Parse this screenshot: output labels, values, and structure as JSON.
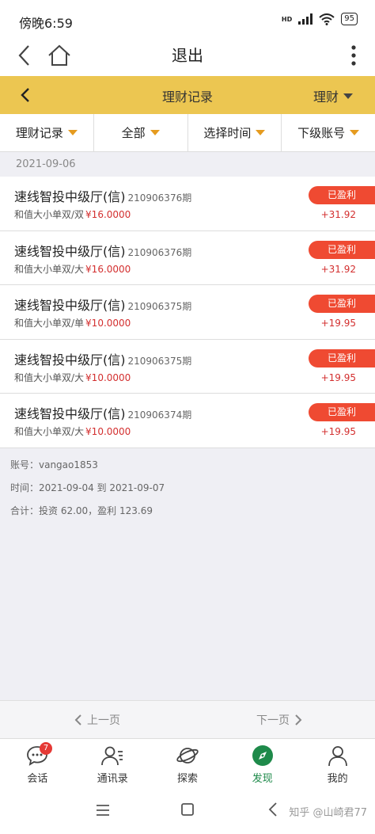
{
  "status": {
    "time": "傍晚6:59",
    "network": "HD",
    "battery": "95"
  },
  "appbar": {
    "title": "退出"
  },
  "section": {
    "title": "理财记录",
    "menu_label": "理财"
  },
  "filters": [
    {
      "label": "理财记录"
    },
    {
      "label": "全部"
    },
    {
      "label": "选择时间"
    },
    {
      "label": "下级账号"
    }
  ],
  "date_header": "2021-09-06",
  "records": [
    {
      "name": "速线智投中级厅(信)",
      "period": "210906376期",
      "bet": "和值大小单双/双",
      "stake": "¥16.0000",
      "status": "已盈利",
      "profit": "+31.92"
    },
    {
      "name": "速线智投中级厅(信)",
      "period": "210906376期",
      "bet": "和值大小单双/大",
      "stake": "¥16.0000",
      "status": "已盈利",
      "profit": "+31.92"
    },
    {
      "name": "速线智投中级厅(信)",
      "period": "210906375期",
      "bet": "和值大小单双/单",
      "stake": "¥10.0000",
      "status": "已盈利",
      "profit": "+19.95"
    },
    {
      "name": "速线智投中级厅(信)",
      "period": "210906375期",
      "bet": "和值大小单双/大",
      "stake": "¥10.0000",
      "status": "已盈利",
      "profit": "+19.95"
    },
    {
      "name": "速线智投中级厅(信)",
      "period": "210906374期",
      "bet": "和值大小单双/大",
      "stake": "¥10.0000",
      "status": "已盈利",
      "profit": "+19.95"
    }
  ],
  "summary": {
    "account": "账号：vangao1853",
    "period": "时间：2021-09-04 到 2021-09-07",
    "total": "合计：投资 62.00，盈利 123.69"
  },
  "pager": {
    "prev": "上一页",
    "next": "下一页"
  },
  "tabs": [
    {
      "label": "会话",
      "badge": "7"
    },
    {
      "label": "通讯录"
    },
    {
      "label": "探索"
    },
    {
      "label": "发现"
    },
    {
      "label": "我的"
    }
  ],
  "watermark": "知乎 @山崎君77",
  "colors": {
    "accent_yellow": "#ecc651",
    "profit_red": "#ef4a32",
    "active_green": "#1e8a4a"
  }
}
